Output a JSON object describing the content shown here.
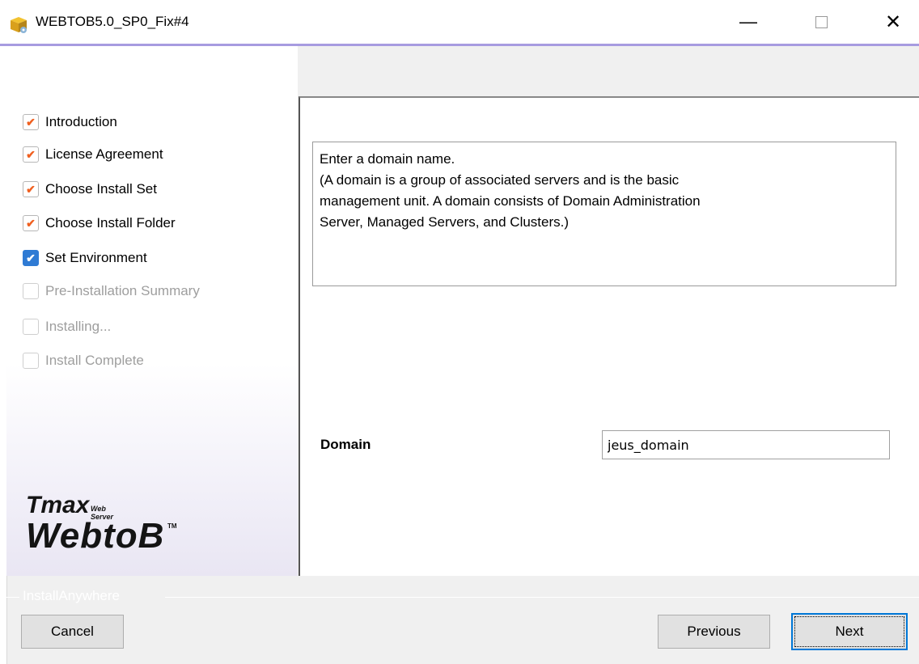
{
  "window": {
    "title": "WEBTOB5.0_SP0_Fix#4",
    "icon": "installer-box-icon",
    "controls": {
      "minimize": "—",
      "close": "✕"
    },
    "accent_color": "#a79be0"
  },
  "steps": [
    {
      "label": "Introduction",
      "status": "done"
    },
    {
      "label": "License Agreement",
      "status": "done"
    },
    {
      "label": "Choose Install Set",
      "status": "done"
    },
    {
      "label": "Choose Install Folder",
      "status": "done"
    },
    {
      "label": "Set Environment",
      "status": "current"
    },
    {
      "label": "Pre-Installation Summary",
      "status": "pending"
    },
    {
      "label": "Installing...",
      "status": "pending"
    },
    {
      "label": "Install Complete",
      "status": "pending"
    }
  ],
  "logo": {
    "line1": "Tmax",
    "line1_small": "Web Server",
    "line2": "WebtoB",
    "tm": "TM"
  },
  "installer_brand": "InstallAnywhere",
  "main": {
    "description": [
      "Enter a domain name.",
      "(A domain is a group of associated servers and is the basic",
      "management unit. A domain consists of Domain Administration",
      "Server, Managed Servers, and Clusters.)"
    ],
    "domain_label": "Domain",
    "domain_value": "jeus_domain"
  },
  "buttons": {
    "cancel": "Cancel",
    "previous": "Previous",
    "next": "Next"
  },
  "colors": {
    "check_done": "#f06020",
    "check_current": "#2f7bd4",
    "focus_border": "#0078d7"
  }
}
